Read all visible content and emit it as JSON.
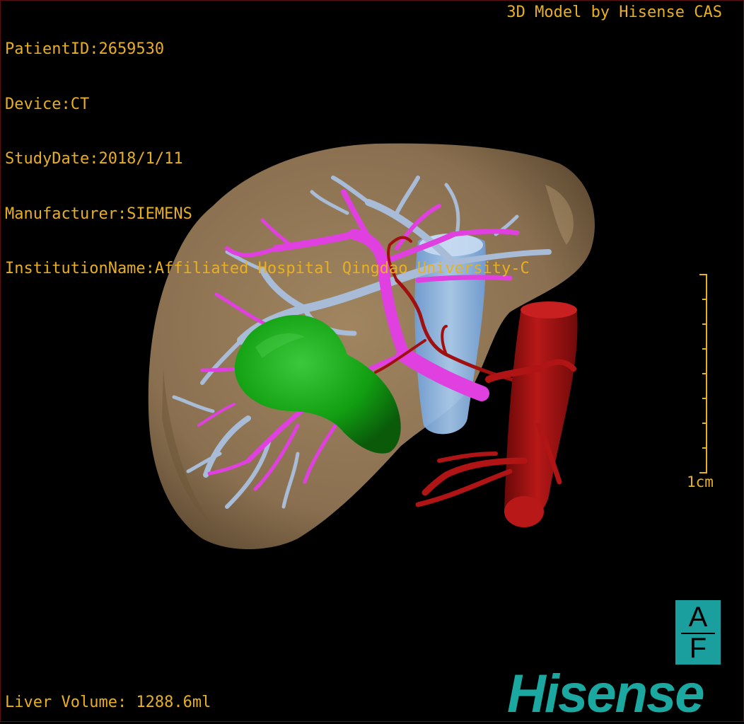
{
  "viewer": {
    "brand_credit": "3D Model by Hisense CAS",
    "patient_info": [
      "PatientID:2659530",
      "Device:CT",
      "StudyDate:2018/1/11",
      "Manufacturer:SIEMENS",
      "InstitutionName:Affiliated Hospital Qingdao University-C"
    ],
    "scale_label": "1cm",
    "liver_volume": "Liver Volume: 1288.6ml",
    "orientation": {
      "top": "A",
      "bottom": "F"
    },
    "logo_text": "Hisense"
  },
  "colors": {
    "overlay_text": "#e8b020",
    "liver": "#8a7050",
    "portal_vein": "#e040e0",
    "hepatic_vein": "#a8c0e0",
    "artery": "#a01010",
    "tumor": "#10a010",
    "ivc": "#8cb8e8",
    "brand": "#1aa8a0"
  }
}
